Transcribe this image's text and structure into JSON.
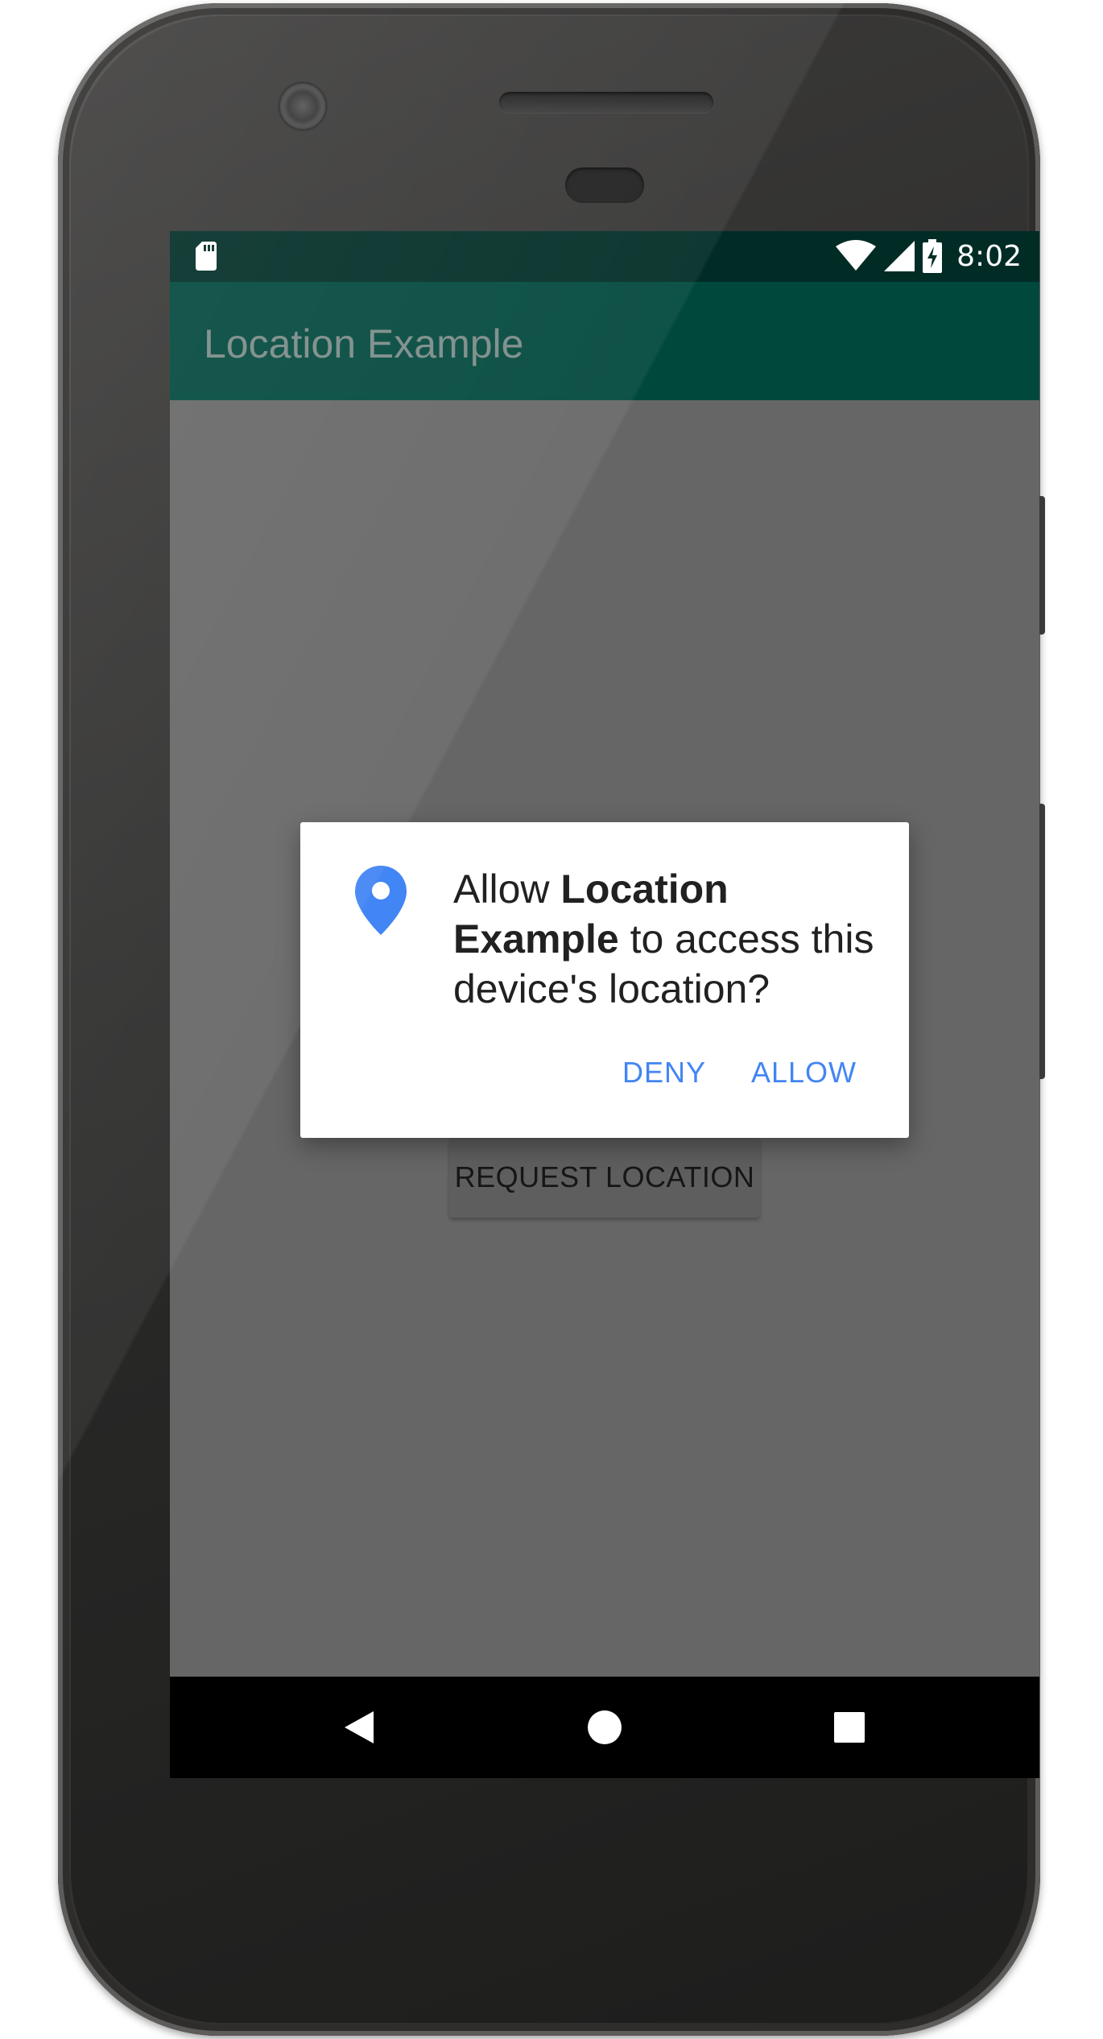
{
  "status_bar": {
    "time": "8:02",
    "icons": [
      "sd-card-icon",
      "wifi-icon",
      "cell-signal-icon",
      "battery-charging-icon"
    ]
  },
  "app_bar": {
    "title": "Location Example"
  },
  "main": {
    "request_button_label": "REQUEST LOCATION"
  },
  "dialog": {
    "icon": "location-pin-icon",
    "icon_color": "#4285f4",
    "message_prefix": "Allow ",
    "app_name": "Location Example",
    "message_suffix": " to access this device's location?",
    "deny_label": "DENY",
    "allow_label": "ALLOW",
    "button_color": "#4285f4"
  },
  "nav_bar": {
    "icons": [
      "back-icon",
      "home-icon",
      "recents-icon"
    ]
  },
  "colors": {
    "status_bar": "#002c25",
    "app_bar": "#00473c",
    "scrim_background": "#666666"
  }
}
